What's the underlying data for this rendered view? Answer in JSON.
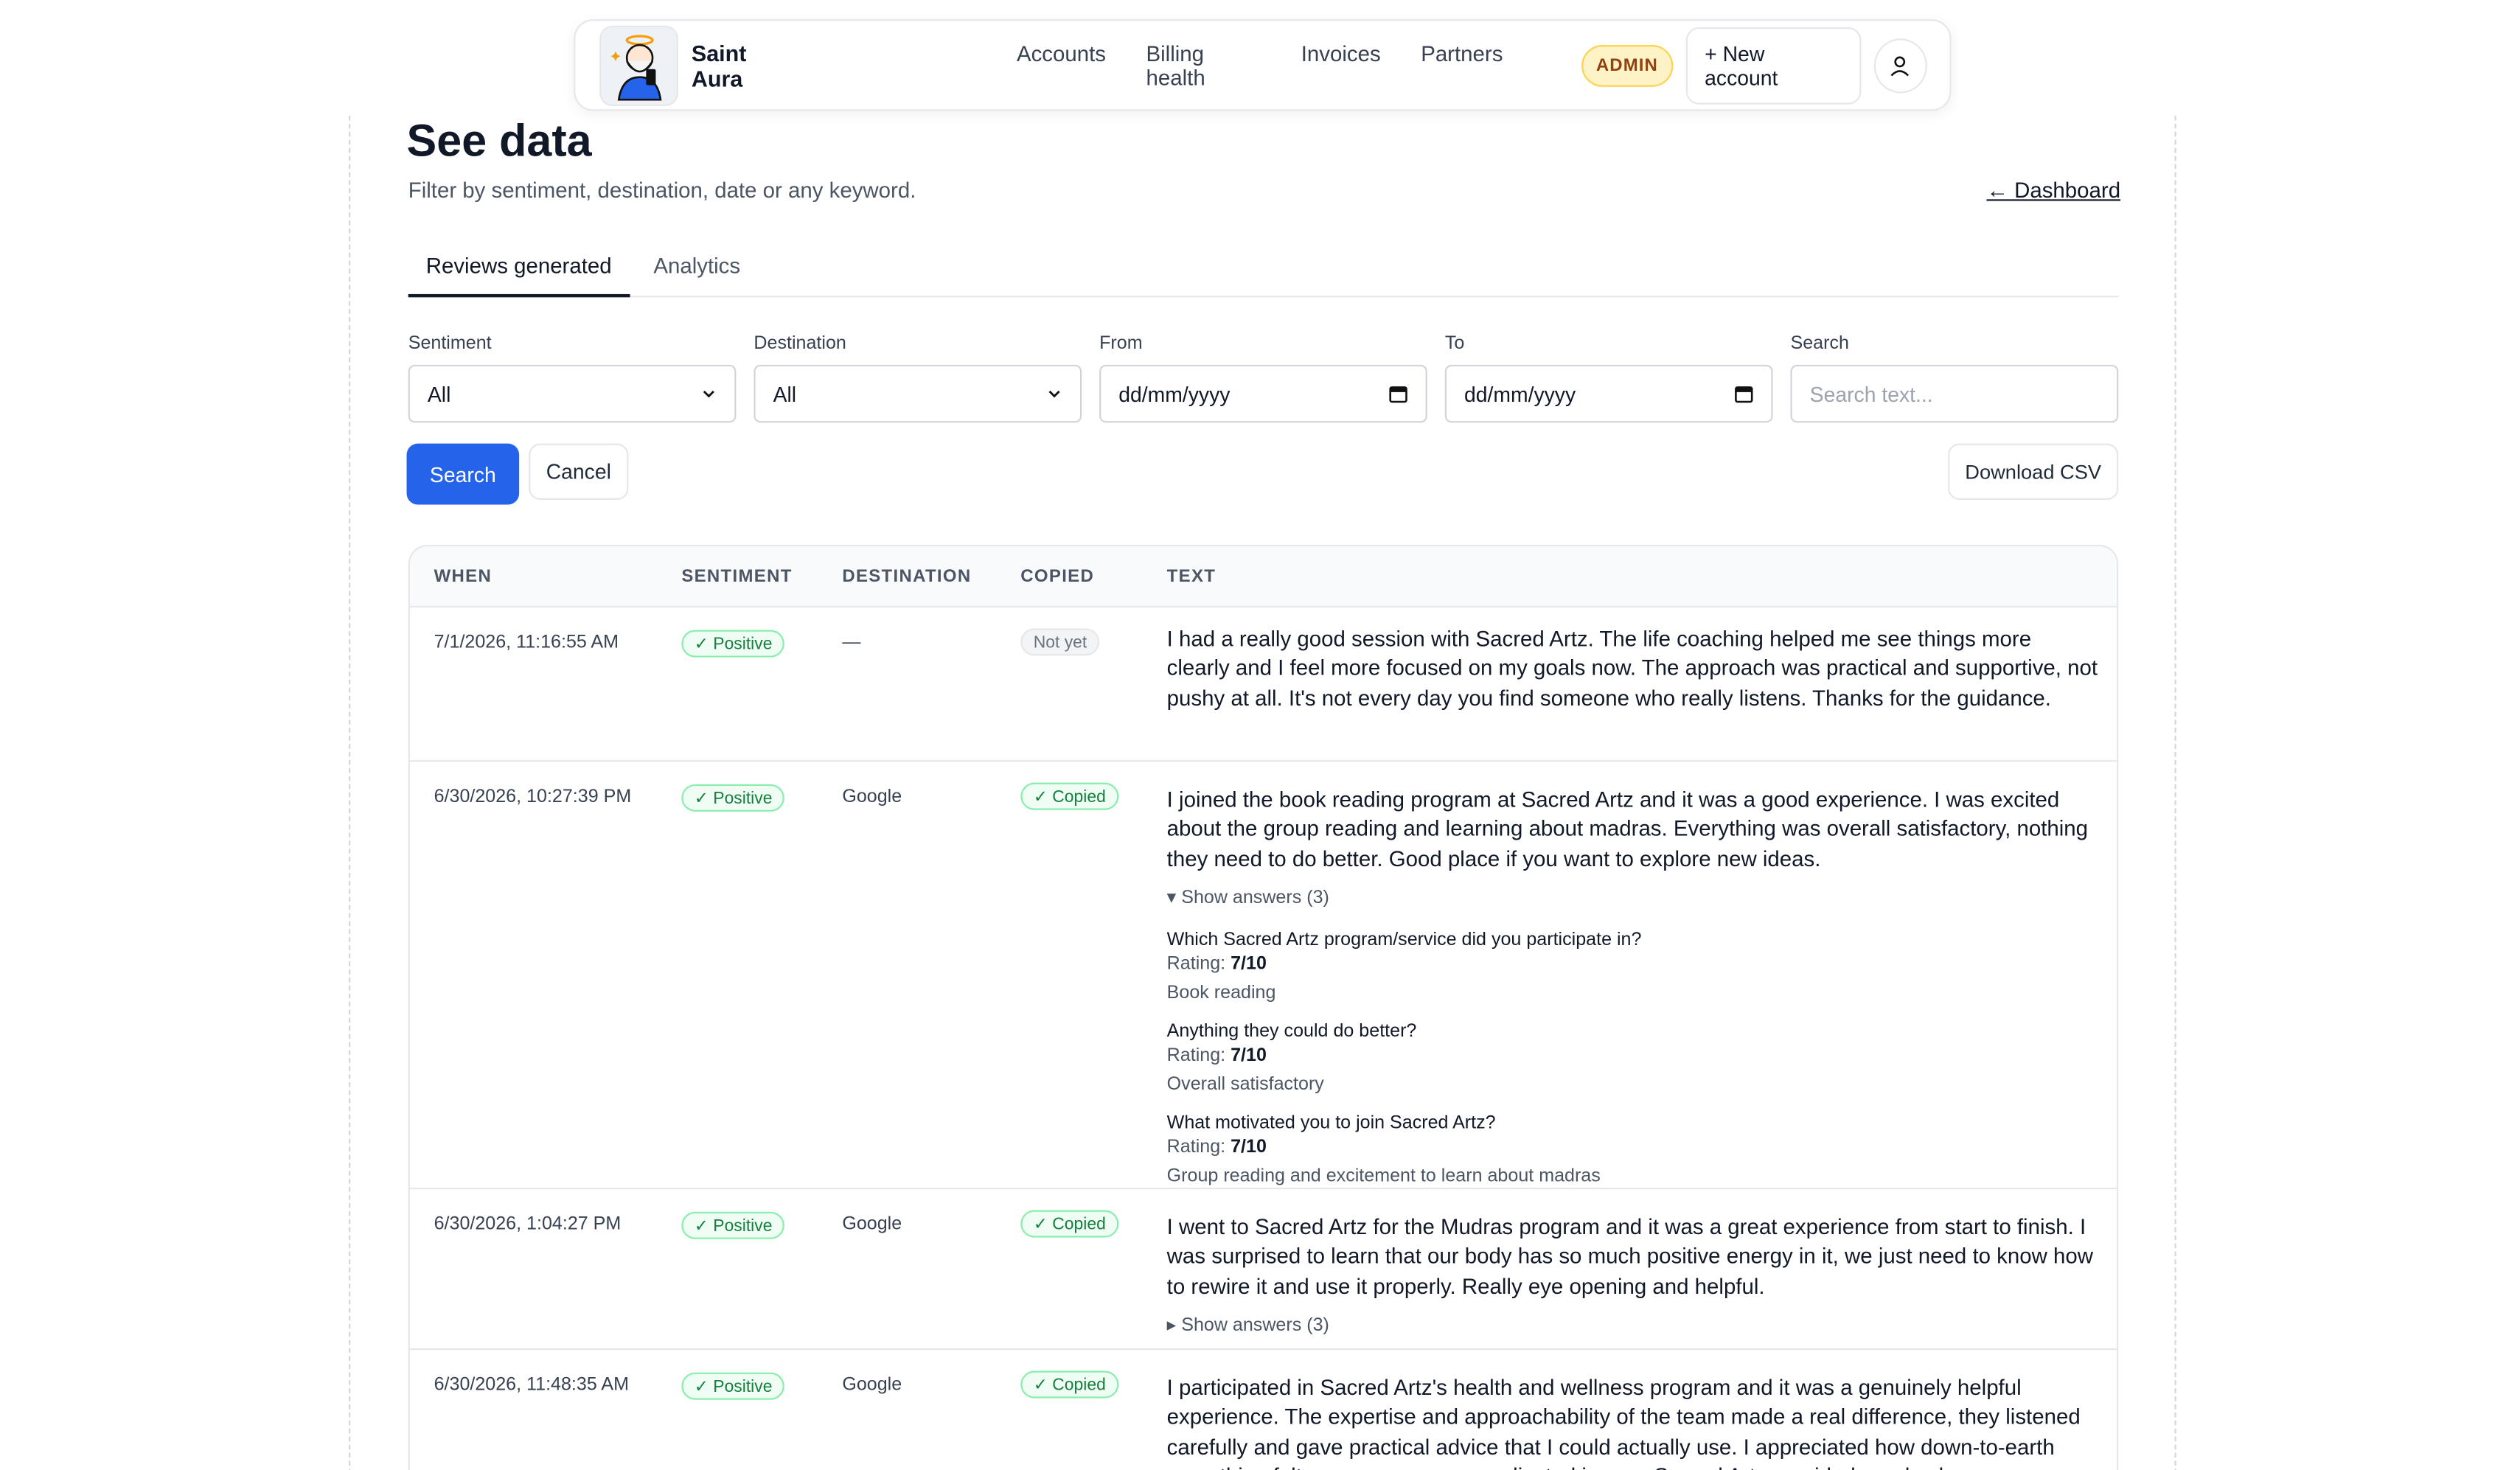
{
  "header": {
    "brand": "Saint Aura",
    "nav": [
      "Accounts",
      "Billing health",
      "Invoices",
      "Partners"
    ],
    "admin_badge": "ADMIN",
    "new_account": "+ New account"
  },
  "page": {
    "title": "See data",
    "subtitle": "Filter by sentiment, destination, date or any keyword.",
    "dashboard_link": "← Dashboard"
  },
  "tabs": [
    "Reviews generated",
    "Analytics"
  ],
  "filters": {
    "sentiment_label": "Sentiment",
    "sentiment_value": "All",
    "destination_label": "Destination",
    "destination_value": "All",
    "from_label": "From",
    "from_value": "dd/mm/yyyy",
    "to_label": "To",
    "to_value": "dd/mm/yyyy",
    "search_label": "Search",
    "search_placeholder": "Search text..."
  },
  "actions": {
    "search": "Search",
    "cancel": "Cancel",
    "download_csv": "Download CSV"
  },
  "table": {
    "headers": [
      "WHEN",
      "SENTIMENT",
      "DESTINATION",
      "COPIED",
      "TEXT"
    ],
    "rows": [
      {
        "when": "7/1/2026, 11:16:55 AM",
        "sentiment": "✓ Positive",
        "destination": "—",
        "copied": "Not yet",
        "text": "I had a really good session with Sacred Artz. The life coaching helped me see things more clearly and I feel more focused on my goals now. The approach was practical and supportive, not pushy at all. It's not every day you find someone who really listens. Thanks for the guidance."
      },
      {
        "when": "6/30/2026, 10:27:39 PM",
        "sentiment": "✓ Positive",
        "destination": "Google",
        "copied": "✓ Copied",
        "text": "I joined the book reading program at Sacred Artz and it was a good experience. I was excited about the group reading and learning about madras. Everything was overall satisfactory, nothing they need to do better. Good place if you want to explore new ideas.",
        "answers_toggle": "▾ Show answers (3)",
        "answers": [
          {
            "q": "Which Sacred Artz program/service did you participate in?",
            "rating_label": "Rating:",
            "rating": "7/10",
            "a": "Book reading"
          },
          {
            "q": "Anything they could do better?",
            "rating_label": "Rating:",
            "rating": "7/10",
            "a": "Overall satisfactory"
          },
          {
            "q": "What motivated you to join Sacred Artz?",
            "rating_label": "Rating:",
            "rating": "7/10",
            "a": "Group reading and excitement to learn about madras"
          }
        ]
      },
      {
        "when": "6/30/2026, 1:04:27 PM",
        "sentiment": "✓ Positive",
        "destination": "Google",
        "copied": "✓ Copied",
        "text": "I went to Sacred Artz for the Mudras program and it was a great experience from start to finish. I was surprised to learn that our body has so much positive energy in it, we just need to know how to rewire it and use it properly. Really eye opening and helpful.",
        "answers_toggle": "▸ Show answers (3)"
      },
      {
        "when": "6/30/2026, 11:48:35 AM",
        "sentiment": "✓ Positive",
        "destination": "Google",
        "copied": "✓ Copied",
        "text": "I participated in Sacred Artz's health and wellness program and it was a genuinely helpful experience. The expertise and approachability of the team made a real difference, they listened carefully and gave practical advice that I could actually use. I appreciated how down-to-earth everything felt, no pressure or complicated jargon. Sacred Artz provided good value"
      }
    ]
  },
  "colors": {
    "primary": "#2563eb",
    "positive": "#15803d",
    "admin_bg": "#fef3c7"
  }
}
